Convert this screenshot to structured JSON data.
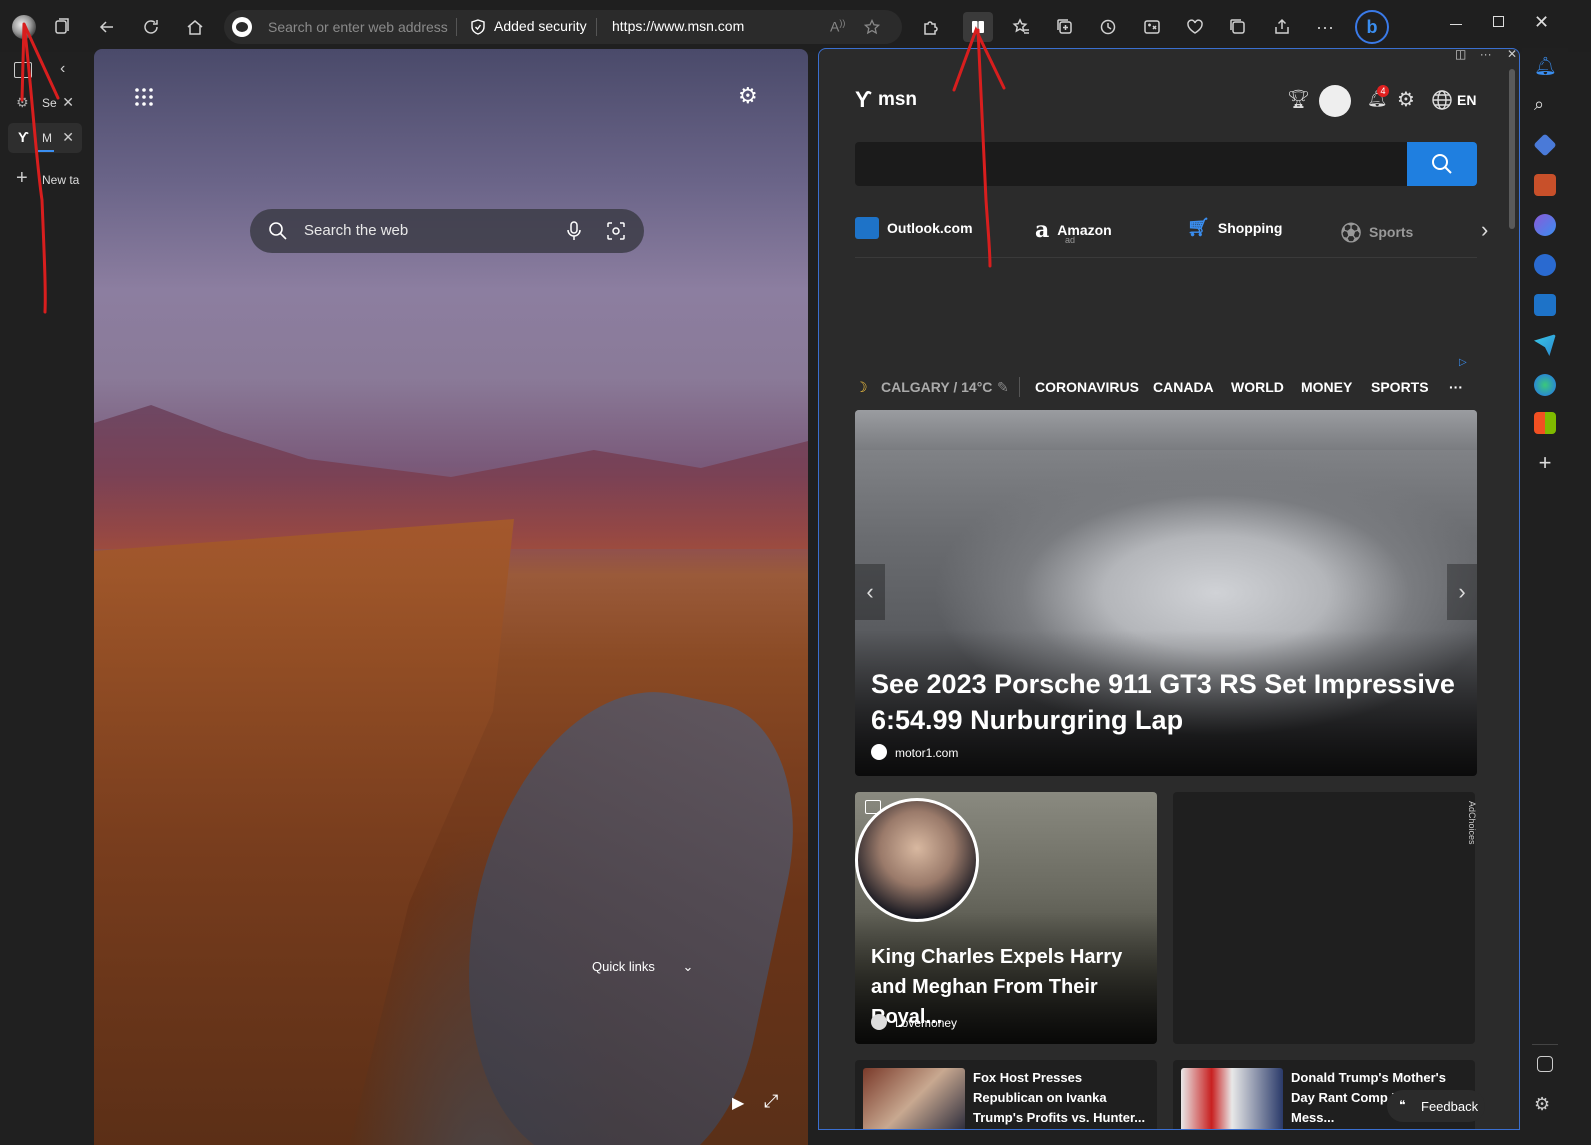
{
  "titlebar": {
    "address_placeholder": "Search or enter web address",
    "security_label": "Added security",
    "url": "https://www.msn.com"
  },
  "vertical_tabs": {
    "tabs": [
      {
        "label": "Se"
      },
      {
        "label": "M"
      },
      {
        "label": "New ta"
      }
    ]
  },
  "new_tab_page": {
    "search_placeholder": "Search the web",
    "quick_links_label": "Quick links"
  },
  "msn": {
    "brand": "msn",
    "notification_count": "4",
    "language": "EN",
    "quick_links": [
      {
        "label": "Outlook.com"
      },
      {
        "label": "Amazon",
        "sub": "ad"
      },
      {
        "label": "Shopping"
      },
      {
        "label": "Sports"
      }
    ],
    "weather": "CALGARY / 14°C",
    "nav": [
      "CORONAVIRUS",
      "CANADA",
      "WORLD",
      "MONEY",
      "SPORTS"
    ],
    "hero": {
      "title": "See 2023 Porsche 911 GT3 RS Set Impressive 6:54.99 Nurburgring Lap",
      "source": "motor1.com"
    },
    "card1": {
      "title": "King Charles Expels Harry and Meghan From Their Royal...",
      "source": "Lovemoney"
    },
    "ad_choices": "AdChoices",
    "small_cards": [
      {
        "title": "Fox Host Presses Republican on Ivanka Trump's Profits vs. Hunter..."
      },
      {
        "title": "Donald Trump's Mother's Day Rant Comp DeSantis' Mess..."
      }
    ],
    "feedback_label": "Feedback"
  },
  "colors": {
    "accent": "#1f7fe0",
    "pane_border": "#3a6fd0",
    "annotation": "#d81e1e"
  }
}
